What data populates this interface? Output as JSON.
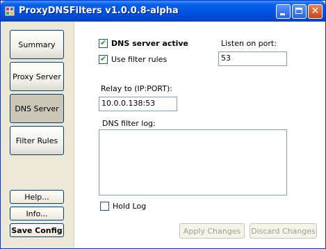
{
  "window": {
    "title": "ProxyDNSFilters v1.0.0.8-alpha",
    "icon": "app-icon",
    "caption_buttons": {
      "minimize": "minimize-icon",
      "maximize": "maximize-icon",
      "close": "✕"
    }
  },
  "sidebar": {
    "items": [
      {
        "label": "Summary",
        "active": false
      },
      {
        "label": "Proxy Server",
        "active": false
      },
      {
        "label": "DNS Server",
        "active": true
      },
      {
        "label": "Filter Rules",
        "active": false
      }
    ],
    "help_label": "Help...",
    "info_label": "Info...",
    "save_label": "Save Config"
  },
  "dns": {
    "server_active_label": "DNS server active",
    "server_active_checked": true,
    "use_filter_label": "Use filter rules",
    "use_filter_checked": true,
    "listen_port_label": "Listen on port:",
    "listen_port_value": "53",
    "relay_label": "Relay to (IP:PORT):",
    "relay_value": "10.0.0.138:53",
    "log_label": "DNS filter log:",
    "log_value": "",
    "hold_log_label": "Hold Log",
    "hold_log_checked": false,
    "apply_label": "Apply Changes",
    "discard_label": "Discard Changes"
  },
  "colors": {
    "titlebar": "#0055e5",
    "check": "#21a121",
    "disabled_text": "#a19f8a"
  }
}
